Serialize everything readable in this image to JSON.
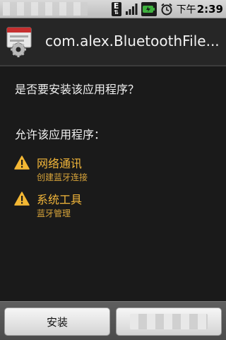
{
  "status_bar": {
    "network_label": "E",
    "time_ampm": "下午",
    "time": "2:39",
    "icons": [
      "edge-network-icon",
      "signal-icon",
      "battery-icon",
      "alarm-icon"
    ]
  },
  "title_bar": {
    "title": "com.alex.BluetoothFile..."
  },
  "content": {
    "question": "是否要安装该应用程序？",
    "permissions_header": "允许该应用程序：",
    "permissions": [
      {
        "title": "网络通讯",
        "description": "创建蓝牙连接",
        "icon": "warning-icon"
      },
      {
        "title": "系统工具",
        "description": "蓝牙管理",
        "icon": "warning-icon"
      }
    ]
  },
  "buttons": {
    "install_label": "安装",
    "cancel_label": ""
  },
  "colors": {
    "background": "#1a1a1a",
    "permission_title": "#f2b63a",
    "permission_desc": "#d9a53a",
    "warning_icon": "#f3b734"
  }
}
